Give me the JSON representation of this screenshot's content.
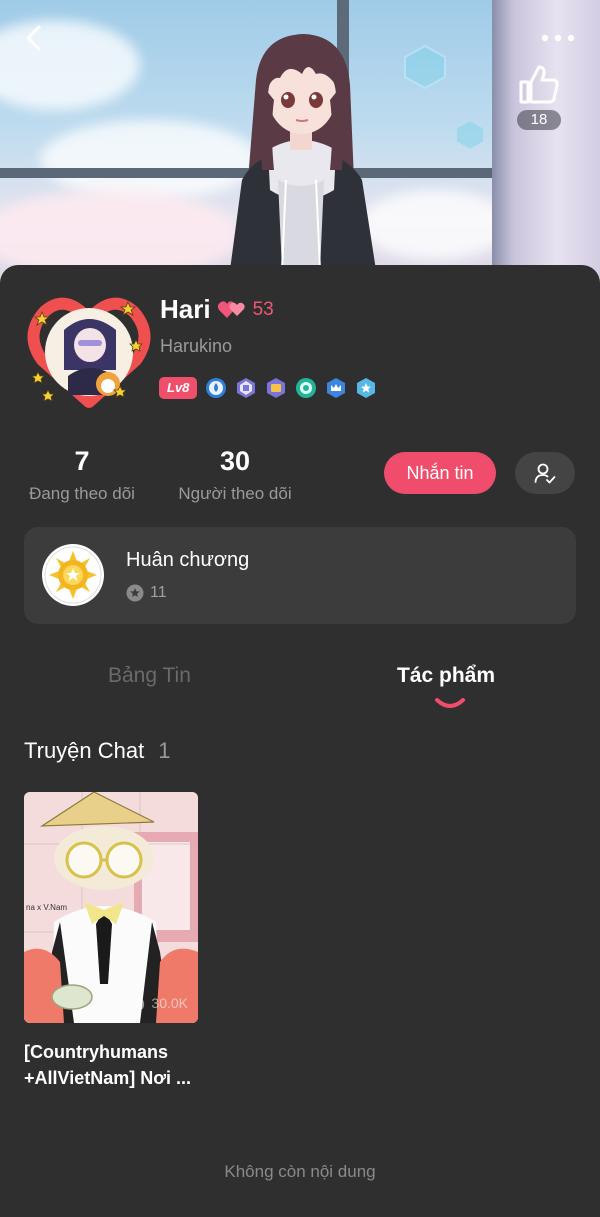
{
  "header": {
    "back_icon": "chevron-left-icon",
    "more_icon": "more-horizontal-icon",
    "like_icon": "thumbs-up-icon",
    "like_count": "18"
  },
  "profile": {
    "name": "Hari",
    "name_icon": "hearts-icon",
    "name_number": "53",
    "username": "Harukino",
    "level": "Lv8",
    "badges": [
      "drop-medal-icon",
      "book-medal-icon",
      "card-medal-icon",
      "leaf-medal-icon",
      "crown-medal-icon",
      "star-medal-icon"
    ]
  },
  "stats": {
    "following_count": "7",
    "following_label": "Đang theo dõi",
    "followers_count": "30",
    "followers_label": "Người theo dõi"
  },
  "actions": {
    "message_label": "Nhắn tin",
    "follow_icon": "user-check-icon"
  },
  "medals": {
    "title": "Huân chương",
    "count": "11"
  },
  "tabs": [
    {
      "label": "Bảng Tin",
      "active": false
    },
    {
      "label": "Tác phẩm",
      "active": true
    }
  ],
  "section": {
    "title": "Truyện Chat",
    "count": "1"
  },
  "stories": [
    {
      "title_line1": "[Countryhumans",
      "title_line2": "+AllVietNam] Nơi ...",
      "views": "30.0K",
      "cover_text": "na x V.Nam"
    }
  ],
  "footer": {
    "end_text": "Không còn nội dung"
  },
  "colors": {
    "accent": "#f04c6b",
    "background": "#2f2f2f",
    "card": "#3c3c3c"
  }
}
